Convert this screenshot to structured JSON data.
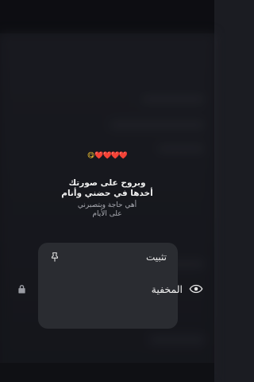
{
  "preview": {
    "emoji": "😋",
    "hearts": "❤️❤️❤️❤️",
    "lines": [
      "وبروح على صورتك",
      "أخدها في حضني وأنام"
    ],
    "sub_lines": [
      "أهي حاجة وبتصبرني",
      "على الأيام"
    ]
  },
  "menu": {
    "pin": {
      "label": "تثبيت",
      "icon": "pin-icon"
    }
  },
  "hidden_chats": {
    "label": "المخفية",
    "icon": "eye-icon",
    "lock_icon": "lock-icon"
  }
}
